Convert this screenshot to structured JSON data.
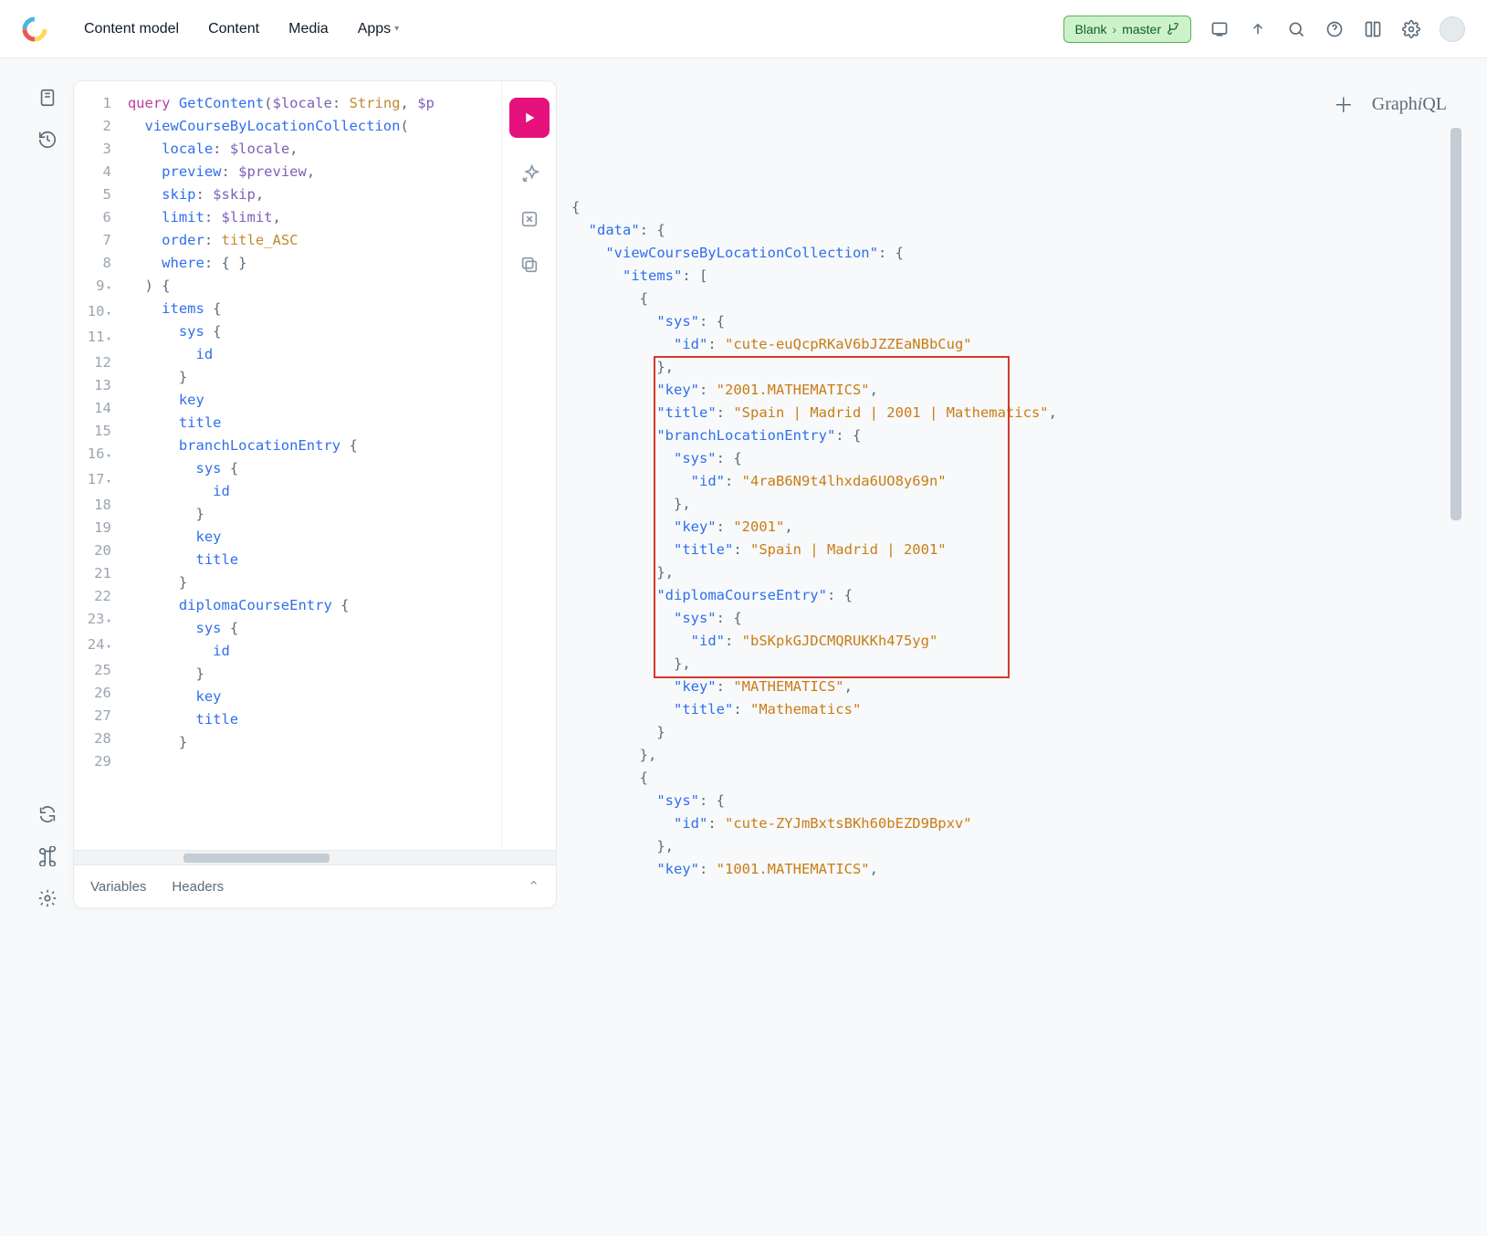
{
  "nav": {
    "items": [
      "Content model",
      "Content",
      "Media",
      "Apps"
    ]
  },
  "env": {
    "space": "Blank",
    "env_name": "master"
  },
  "graphiql": {
    "brand_prefix": "Graph",
    "brand_i": "i",
    "brand_suffix": "QL"
  },
  "bottom_tabs": {
    "variables": "Variables",
    "headers": "Headers"
  },
  "editor": {
    "lines": [
      {
        "n": "1",
        "fold": false,
        "tokens": [
          [
            "k-keyword",
            "query"
          ],
          [
            "",
            " "
          ],
          [
            "k-def",
            "GetContent"
          ],
          [
            "k-punc",
            "("
          ],
          [
            "k-var",
            "$locale"
          ],
          [
            "k-punc",
            ": "
          ],
          [
            "k-type",
            "String"
          ],
          [
            "k-punc",
            ", "
          ],
          [
            "k-var",
            "$p"
          ]
        ]
      },
      {
        "n": "2",
        "fold": false,
        "tokens": [
          [
            "",
            "  "
          ],
          [
            "k-field",
            "viewCourseByLocationCollection"
          ],
          [
            "k-punc",
            "("
          ]
        ]
      },
      {
        "n": "3",
        "fold": false,
        "tokens": [
          [
            "",
            "    "
          ],
          [
            "k-prop",
            "locale"
          ],
          [
            "k-punc",
            ": "
          ],
          [
            "k-var",
            "$locale"
          ],
          [
            "k-punc",
            ","
          ]
        ]
      },
      {
        "n": "4",
        "fold": false,
        "tokens": [
          [
            "",
            "    "
          ],
          [
            "k-prop",
            "preview"
          ],
          [
            "k-punc",
            ": "
          ],
          [
            "k-var",
            "$preview"
          ],
          [
            "k-punc",
            ","
          ]
        ]
      },
      {
        "n": "5",
        "fold": false,
        "tokens": [
          [
            "",
            "    "
          ],
          [
            "k-prop",
            "skip"
          ],
          [
            "k-punc",
            ": "
          ],
          [
            "k-var",
            "$skip"
          ],
          [
            "k-punc",
            ","
          ]
        ]
      },
      {
        "n": "6",
        "fold": false,
        "tokens": [
          [
            "",
            "    "
          ],
          [
            "k-prop",
            "limit"
          ],
          [
            "k-punc",
            ": "
          ],
          [
            "k-var",
            "$limit"
          ],
          [
            "k-punc",
            ","
          ]
        ]
      },
      {
        "n": "7",
        "fold": false,
        "tokens": [
          [
            "",
            "    "
          ],
          [
            "k-prop",
            "order"
          ],
          [
            "k-punc",
            ": "
          ],
          [
            "k-const",
            "title_ASC"
          ]
        ]
      },
      {
        "n": "8",
        "fold": false,
        "tokens": [
          [
            "",
            "    "
          ],
          [
            "k-prop",
            "where"
          ],
          [
            "k-punc",
            ": { }"
          ]
        ]
      },
      {
        "n": "9",
        "fold": true,
        "tokens": [
          [
            "",
            "  "
          ],
          [
            "k-punc",
            ") {"
          ]
        ]
      },
      {
        "n": "10",
        "fold": true,
        "tokens": [
          [
            "",
            "    "
          ],
          [
            "k-field",
            "items"
          ],
          [
            "k-punc",
            " {"
          ]
        ]
      },
      {
        "n": "11",
        "fold": true,
        "tokens": [
          [
            "",
            "      "
          ],
          [
            "k-field",
            "sys"
          ],
          [
            "k-punc",
            " {"
          ]
        ]
      },
      {
        "n": "12",
        "fold": false,
        "tokens": [
          [
            "",
            "        "
          ],
          [
            "k-field",
            "id"
          ]
        ]
      },
      {
        "n": "13",
        "fold": false,
        "tokens": [
          [
            "",
            "      "
          ],
          [
            "k-punc",
            "}"
          ]
        ]
      },
      {
        "n": "14",
        "fold": false,
        "tokens": [
          [
            "",
            "      "
          ],
          [
            "k-field",
            "key"
          ]
        ]
      },
      {
        "n": "15",
        "fold": false,
        "tokens": [
          [
            "",
            "      "
          ],
          [
            "k-field",
            "title"
          ]
        ]
      },
      {
        "n": "16",
        "fold": true,
        "tokens": [
          [
            "",
            "      "
          ],
          [
            "k-field",
            "branchLocationEntry"
          ],
          [
            "k-punc",
            " {"
          ]
        ]
      },
      {
        "n": "17",
        "fold": true,
        "tokens": [
          [
            "",
            "        "
          ],
          [
            "k-field",
            "sys"
          ],
          [
            "k-punc",
            " {"
          ]
        ]
      },
      {
        "n": "18",
        "fold": false,
        "tokens": [
          [
            "",
            "          "
          ],
          [
            "k-field",
            "id"
          ]
        ]
      },
      {
        "n": "19",
        "fold": false,
        "tokens": [
          [
            "",
            "        "
          ],
          [
            "k-punc",
            "}"
          ]
        ]
      },
      {
        "n": "20",
        "fold": false,
        "tokens": [
          [
            "",
            "        "
          ],
          [
            "k-field",
            "key"
          ]
        ]
      },
      {
        "n": "21",
        "fold": false,
        "tokens": [
          [
            "",
            "        "
          ],
          [
            "k-field",
            "title"
          ]
        ]
      },
      {
        "n": "22",
        "fold": false,
        "tokens": [
          [
            "",
            "      "
          ],
          [
            "k-punc",
            "}"
          ]
        ]
      },
      {
        "n": "23",
        "fold": true,
        "tokens": [
          [
            "",
            "      "
          ],
          [
            "k-field",
            "diplomaCourseEntry"
          ],
          [
            "k-punc",
            " {"
          ]
        ]
      },
      {
        "n": "24",
        "fold": true,
        "tokens": [
          [
            "",
            "        "
          ],
          [
            "k-field",
            "sys"
          ],
          [
            "k-punc",
            " {"
          ]
        ]
      },
      {
        "n": "25",
        "fold": false,
        "tokens": [
          [
            "",
            "          "
          ],
          [
            "k-field",
            "id"
          ]
        ]
      },
      {
        "n": "26",
        "fold": false,
        "tokens": [
          [
            "",
            "        "
          ],
          [
            "k-punc",
            "}"
          ]
        ]
      },
      {
        "n": "27",
        "fold": false,
        "tokens": [
          [
            "",
            "        "
          ],
          [
            "k-field",
            "key"
          ]
        ]
      },
      {
        "n": "28",
        "fold": false,
        "tokens": [
          [
            "",
            "        "
          ],
          [
            "k-field",
            "title"
          ]
        ]
      },
      {
        "n": "29",
        "fold": false,
        "tokens": [
          [
            "",
            "      "
          ],
          [
            "k-punc",
            "}"
          ]
        ]
      }
    ]
  },
  "result": {
    "lines": [
      [
        [
          "r-punc",
          "{"
        ]
      ],
      [
        [
          "",
          "  "
        ],
        [
          "r-key",
          "\"data\""
        ],
        [
          "r-punc",
          ": {"
        ]
      ],
      [
        [
          "",
          "    "
        ],
        [
          "r-key",
          "\"viewCourseByLocationCollection\""
        ],
        [
          "r-punc",
          ": {"
        ]
      ],
      [
        [
          "",
          "      "
        ],
        [
          "r-key",
          "\"items\""
        ],
        [
          "r-punc",
          ": ["
        ]
      ],
      [
        [
          "",
          "        "
        ],
        [
          "r-punc",
          "{"
        ]
      ],
      [
        [
          "",
          "          "
        ],
        [
          "r-key",
          "\"sys\""
        ],
        [
          "r-punc",
          ": {"
        ]
      ],
      [
        [
          "",
          "            "
        ],
        [
          "r-key",
          "\"id\""
        ],
        [
          "r-punc",
          ": "
        ],
        [
          "r-str",
          "\"cute-euQcpRKaV6bJZZEaNBbCug\""
        ]
      ],
      [
        [
          "",
          "          "
        ],
        [
          "r-punc",
          "},"
        ]
      ],
      [
        [
          "",
          "          "
        ],
        [
          "r-key",
          "\"key\""
        ],
        [
          "r-punc",
          ": "
        ],
        [
          "r-str",
          "\"2001.MATHEMATICS\""
        ],
        [
          "r-punc",
          ","
        ]
      ],
      [
        [
          "",
          "          "
        ],
        [
          "r-key",
          "\"title\""
        ],
        [
          "r-punc",
          ": "
        ],
        [
          "r-str",
          "\"Spain | Madrid | 2001 | Mathematics\""
        ],
        [
          "r-punc",
          ","
        ]
      ],
      [
        [
          "",
          "          "
        ],
        [
          "r-key",
          "\"branchLocationEntry\""
        ],
        [
          "r-punc",
          ": {"
        ]
      ],
      [
        [
          "",
          "            "
        ],
        [
          "r-key",
          "\"sys\""
        ],
        [
          "r-punc",
          ": {"
        ]
      ],
      [
        [
          "",
          "              "
        ],
        [
          "r-key",
          "\"id\""
        ],
        [
          "r-punc",
          ": "
        ],
        [
          "r-str",
          "\"4raB6N9t4lhxda6UO8y69n\""
        ]
      ],
      [
        [
          "",
          "            "
        ],
        [
          "r-punc",
          "},"
        ]
      ],
      [
        [
          "",
          "            "
        ],
        [
          "r-key",
          "\"key\""
        ],
        [
          "r-punc",
          ": "
        ],
        [
          "r-str",
          "\"2001\""
        ],
        [
          "r-punc",
          ","
        ]
      ],
      [
        [
          "",
          "            "
        ],
        [
          "r-key",
          "\"title\""
        ],
        [
          "r-punc",
          ": "
        ],
        [
          "r-str",
          "\"Spain | Madrid | 2001\""
        ]
      ],
      [
        [
          "",
          "          "
        ],
        [
          "r-punc",
          "},"
        ]
      ],
      [
        [
          "",
          "          "
        ],
        [
          "r-key",
          "\"diplomaCourseEntry\""
        ],
        [
          "r-punc",
          ": {"
        ]
      ],
      [
        [
          "",
          "            "
        ],
        [
          "r-key",
          "\"sys\""
        ],
        [
          "r-punc",
          ": {"
        ]
      ],
      [
        [
          "",
          "              "
        ],
        [
          "r-key",
          "\"id\""
        ],
        [
          "r-punc",
          ": "
        ],
        [
          "r-str",
          "\"bSKpkGJDCMQRUKKh475yg\""
        ]
      ],
      [
        [
          "",
          "            "
        ],
        [
          "r-punc",
          "},"
        ]
      ],
      [
        [
          "",
          "            "
        ],
        [
          "r-key",
          "\"key\""
        ],
        [
          "r-punc",
          ": "
        ],
        [
          "r-str",
          "\"MATHEMATICS\""
        ],
        [
          "r-punc",
          ","
        ]
      ],
      [
        [
          "",
          "            "
        ],
        [
          "r-key",
          "\"title\""
        ],
        [
          "r-punc",
          ": "
        ],
        [
          "r-str",
          "\"Mathematics\""
        ]
      ],
      [
        [
          "",
          "          "
        ],
        [
          "r-punc",
          "}"
        ]
      ],
      [
        [
          "",
          "        "
        ],
        [
          "r-punc",
          "},"
        ]
      ],
      [
        [
          "",
          "        "
        ],
        [
          "r-punc",
          "{"
        ]
      ],
      [
        [
          "",
          "          "
        ],
        [
          "r-key",
          "\"sys\""
        ],
        [
          "r-punc",
          ": {"
        ]
      ],
      [
        [
          "",
          "            "
        ],
        [
          "r-key",
          "\"id\""
        ],
        [
          "r-punc",
          ": "
        ],
        [
          "r-str",
          "\"cute-ZYJmBxtsBKh60bEZD9Bpxv\""
        ]
      ],
      [
        [
          "",
          "          "
        ],
        [
          "r-punc",
          "},"
        ]
      ],
      [
        [
          "",
          "          "
        ],
        [
          "r-key",
          "\"key\""
        ],
        [
          "r-punc",
          ": "
        ],
        [
          "r-str",
          "\"1001.MATHEMATICS\""
        ],
        [
          "r-punc",
          ","
        ]
      ]
    ]
  }
}
